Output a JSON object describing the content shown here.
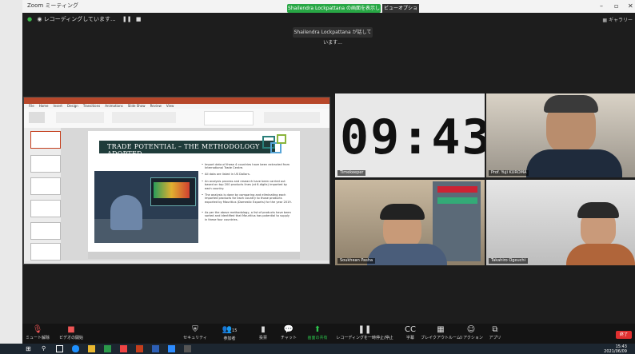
{
  "zoom": {
    "window_title": "Zoom ミーティング",
    "share_banner": "Shailendra Lockpattana の画面を表示しています",
    "view_options": "ビューオプション ▾",
    "recording_status": "レコーディングしています...",
    "sharing_note": "Shailendra Lockpattana が話しています...",
    "gallery_view": "ギャラリー"
  },
  "slide": {
    "title": "TRADE POTENTIAL – THE METHODOLOGY ADOPTED",
    "bullets": [
      "Import data of these 4 countries have been extracted from International Trade Centre.",
      "All data are listed in US Dollars.",
      "An analysis process and research have been carried out based on top 200 products lines (at 6-digits) imported by each country.",
      "The analysis is done by comparing and eliminating each imported products for each country to those products exported by Mauritius (Domestic Exports) for the year 2019.",
      "As per the above methodology, a list of products have been sorted and identified that Mauritius has potential to supply in these four countries."
    ]
  },
  "participants": [
    {
      "name": "Timekeeper",
      "clock": "09:43"
    },
    {
      "name": "Prof. Yuji KUROMA"
    },
    {
      "name": "Soukhean Pasha"
    },
    {
      "name": "Takahiro Ogeuchi"
    }
  ],
  "toolbar": {
    "items": [
      "ミュート解除",
      "ビデオの開始",
      "セキュリティ",
      "参加者",
      "投票",
      "チャット",
      "画面の共有",
      "レコーディングを一時停止/停止",
      "字幕",
      "ブレイクアウトルーム",
      "リアクション",
      "アプリ"
    ],
    "participant_count": "15",
    "end": "終了"
  },
  "taskbar": {
    "time": "15:43",
    "date": "2021/06/09"
  },
  "colors": {
    "accent_green": "#28a745",
    "end_red": "#e02f2f",
    "ppt_red": "#b7472a"
  }
}
